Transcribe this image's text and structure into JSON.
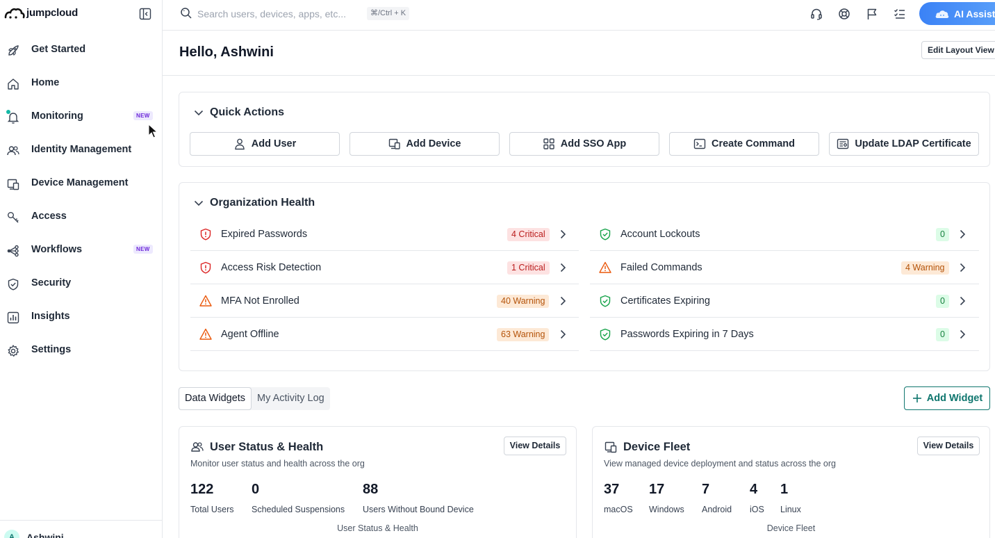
{
  "brand": {
    "name": "jumpcloud"
  },
  "sidebar": {
    "items": [
      {
        "label": "Get Started",
        "icon": "rocket-icon"
      },
      {
        "label": "Home",
        "icon": "home-icon"
      },
      {
        "label": "Monitoring",
        "icon": "bell-icon",
        "badge": "NEW"
      },
      {
        "label": "Identity Management",
        "icon": "users-icon"
      },
      {
        "label": "Device Management",
        "icon": "devices-icon"
      },
      {
        "label": "Access",
        "icon": "key-icon"
      },
      {
        "label": "Workflows",
        "icon": "workflow-icon",
        "badge": "NEW"
      },
      {
        "label": "Security",
        "icon": "shield-icon"
      },
      {
        "label": "Insights",
        "icon": "chart-icon"
      },
      {
        "label": "Settings",
        "icon": "gear-icon"
      }
    ],
    "user": {
      "initial": "A",
      "name": "Ashwini"
    }
  },
  "topbar": {
    "search_placeholder": "Search users, devices, apps, etc...",
    "shortcut": "⌘/Ctrl + K",
    "ai_label": "AI Assistant"
  },
  "header": {
    "greeting": "Hello, Ashwini",
    "edit_layout": "Edit Layout View"
  },
  "quick_actions": {
    "title": "Quick Actions",
    "buttons": [
      "Add User",
      "Add Device",
      "Add SSO App",
      "Create Command",
      "Update LDAP Certificate"
    ]
  },
  "org_health": {
    "title": "Organization Health",
    "left": [
      {
        "label": "Expired Passwords",
        "badge": "4 Critical",
        "level": "critical"
      },
      {
        "label": "Access Risk Detection",
        "badge": "1 Critical",
        "level": "critical"
      },
      {
        "label": "MFA Not Enrolled",
        "badge": "40 Warning",
        "level": "warning"
      },
      {
        "label": "Agent Offline",
        "badge": "63 Warning",
        "level": "warning"
      }
    ],
    "right": [
      {
        "label": "Account Lockouts",
        "badge": "0",
        "level": "ok"
      },
      {
        "label": "Failed Commands",
        "badge": "4 Warning",
        "level": "warning"
      },
      {
        "label": "Certificates Expiring",
        "badge": "0",
        "level": "ok"
      },
      {
        "label": "Passwords Expiring in 7 Days",
        "badge": "0",
        "level": "ok"
      }
    ]
  },
  "tabs": [
    "Data Widgets",
    "My Activity Log"
  ],
  "add_widget": "Add Widget",
  "widgets": {
    "user_status": {
      "title": "User Status & Health",
      "desc": "Monitor user status and health across the org",
      "view": "View Details",
      "stats": [
        {
          "num": "122",
          "lbl": "Total Users"
        },
        {
          "num": "0",
          "lbl": "Scheduled Suspensions"
        },
        {
          "num": "88",
          "lbl": "Users Without Bound Device"
        }
      ],
      "footer": "User Status & Health"
    },
    "device_fleet": {
      "title": "Device Fleet",
      "desc": "View managed device deployment and status across the org",
      "view": "View Details",
      "stats": [
        {
          "num": "37",
          "lbl": "macOS"
        },
        {
          "num": "17",
          "lbl": "Windows"
        },
        {
          "num": "7",
          "lbl": "Android"
        },
        {
          "num": "4",
          "lbl": "iOS"
        },
        {
          "num": "1",
          "lbl": "Linux"
        }
      ],
      "footer": "Device Fleet"
    }
  },
  "colors": {
    "accent": "#0f766e",
    "ai": "#3b82f6",
    "critical": "#b91c1c",
    "warning": "#d97706",
    "ok": "#16a34a"
  }
}
